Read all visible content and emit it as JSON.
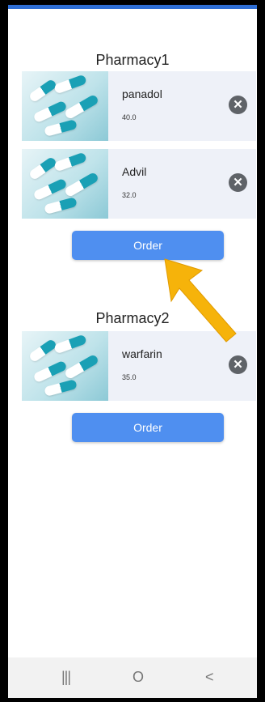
{
  "pharmacies": [
    {
      "name": "Pharmacy1",
      "items": [
        {
          "name": "panadol",
          "price": "40.0"
        },
        {
          "name": "Advil",
          "price": "32.0"
        }
      ],
      "order_label": "Order"
    },
    {
      "name": "Pharmacy2",
      "items": [
        {
          "name": "warfarin",
          "price": "35.0"
        }
      ],
      "order_label": "Order"
    }
  ],
  "icons": {
    "remove": "close-circle-icon",
    "annotation": "arrow-pointer",
    "nav": [
      "recents-icon",
      "home-icon",
      "back-icon"
    ]
  },
  "nav": {
    "recents_glyph": "|||",
    "home_glyph": "O",
    "back_glyph": "<"
  },
  "colors": {
    "order_button": "#4f8ff0",
    "remove_button": "#5f6368",
    "card_background": "#eef1f8",
    "annotation_arrow": "#f6b30a"
  }
}
